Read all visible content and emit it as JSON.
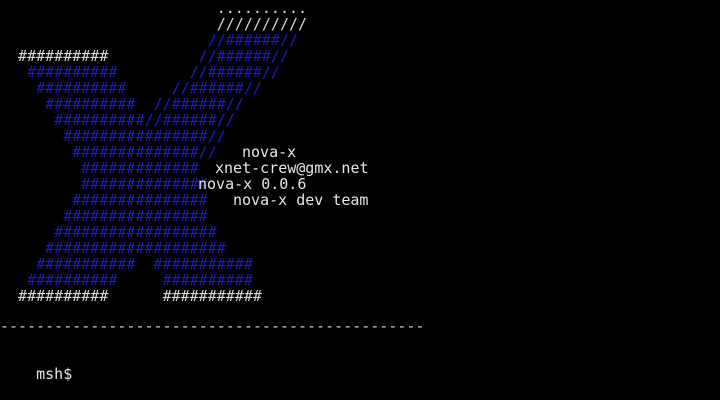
{
  "terminal": {
    "logo_lines": [
      [
        {
          "t": "                        ..........",
          "c": "w"
        }
      ],
      [
        {
          "t": "                        //////////",
          "c": "w"
        }
      ],
      [
        {
          "t": "                       //",
          "c": "b"
        },
        {
          "t": "######",
          "c": "b"
        },
        {
          "t": "//",
          "c": "b"
        }
      ],
      [
        {
          "t": "  ##########",
          "c": "w"
        },
        {
          "t": "          //######//",
          "c": "b"
        }
      ],
      [
        {
          "t": "   ##########        //######//",
          "c": "b"
        }
      ],
      [
        {
          "t": "    ##########     //######//",
          "c": "b"
        }
      ],
      [
        {
          "t": "     ##########  //######//",
          "c": "b"
        }
      ],
      [
        {
          "t": "      ##########//######//",
          "c": "b"
        }
      ],
      [
        {
          "t": "       ################//",
          "c": "b"
        }
      ],
      [
        {
          "t": "        ##############//",
          "c": "b"
        }
      ],
      [
        {
          "t": "         #############",
          "c": "b"
        }
      ],
      [
        {
          "t": "         ##############",
          "c": "b"
        }
      ],
      [
        {
          "t": "        ###############",
          "c": "b"
        }
      ],
      [
        {
          "t": "       ################",
          "c": "b"
        }
      ],
      [
        {
          "t": "      ##################",
          "c": "b"
        }
      ],
      [
        {
          "t": "     ####################",
          "c": "b"
        }
      ],
      [
        {
          "t": "    ###########  ###########",
          "c": "b"
        }
      ],
      [
        {
          "t": "   ##########     ##########",
          "c": "b"
        }
      ],
      [
        {
          "t": "  ##########",
          "c": "w"
        },
        {
          "t": "      ",
          "c": "w"
        },
        {
          "t": "###########",
          "c": "w"
        }
      ]
    ],
    "info": {
      "name": "nova-x",
      "email": "xnet-crew@gmx.net",
      "version": "nova-x 0.0.6",
      "team": "nova-x dev team"
    },
    "separator": "-----------------------------------------------",
    "prompt": "msh$"
  }
}
